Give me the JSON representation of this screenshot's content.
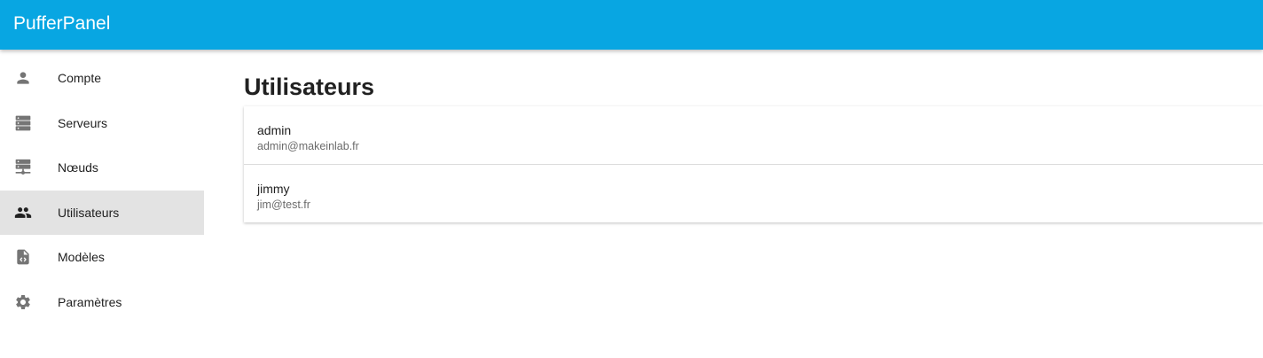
{
  "app": {
    "title": "PufferPanel",
    "brand_color": "#08a6e2"
  },
  "sidebar": {
    "items": [
      {
        "label": "Compte",
        "icon": "account-icon",
        "active": false
      },
      {
        "label": "Serveurs",
        "icon": "servers-icon",
        "active": false
      },
      {
        "label": "Nœuds",
        "icon": "nodes-icon",
        "active": false
      },
      {
        "label": "Utilisateurs",
        "icon": "users-icon",
        "active": true
      },
      {
        "label": "Modèles",
        "icon": "templates-icon",
        "active": false
      },
      {
        "label": "Paramètres",
        "icon": "settings-icon",
        "active": false
      }
    ]
  },
  "main": {
    "title": "Utilisateurs",
    "users": [
      {
        "name": "admin",
        "email": "admin@makeinlab.fr"
      },
      {
        "name": "jimmy",
        "email": "jim@test.fr"
      }
    ]
  }
}
